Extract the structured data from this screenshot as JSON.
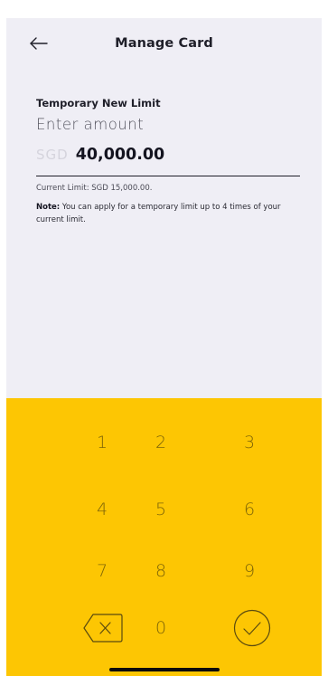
{
  "header": {
    "title": "Manage Card",
    "back_icon": "arrow-left-icon"
  },
  "form": {
    "label": "Temporary New Limit",
    "input_placeholder": "Enter amount",
    "currency": "SGD",
    "amount": "40,000.00",
    "current_limit": "Current Limit: SGD 15,000.00.",
    "note_label": "Note:",
    "note_text": "You can apply for a temporary limit up to 4 times of your current limit."
  },
  "keypad": {
    "keys": [
      "1",
      "2",
      "3",
      "4",
      "5",
      "6",
      "7",
      "8",
      "9"
    ],
    "zero": "0",
    "backspace_icon": "backspace-icon",
    "confirm_icon": "check-circle-icon"
  },
  "colors": {
    "keypad_bg": "#fdc603",
    "panel_bg": "#efeef5",
    "key_text": "#6a5508",
    "primary_text": "#1f1f29",
    "currency_text": "#d5d4dd"
  }
}
